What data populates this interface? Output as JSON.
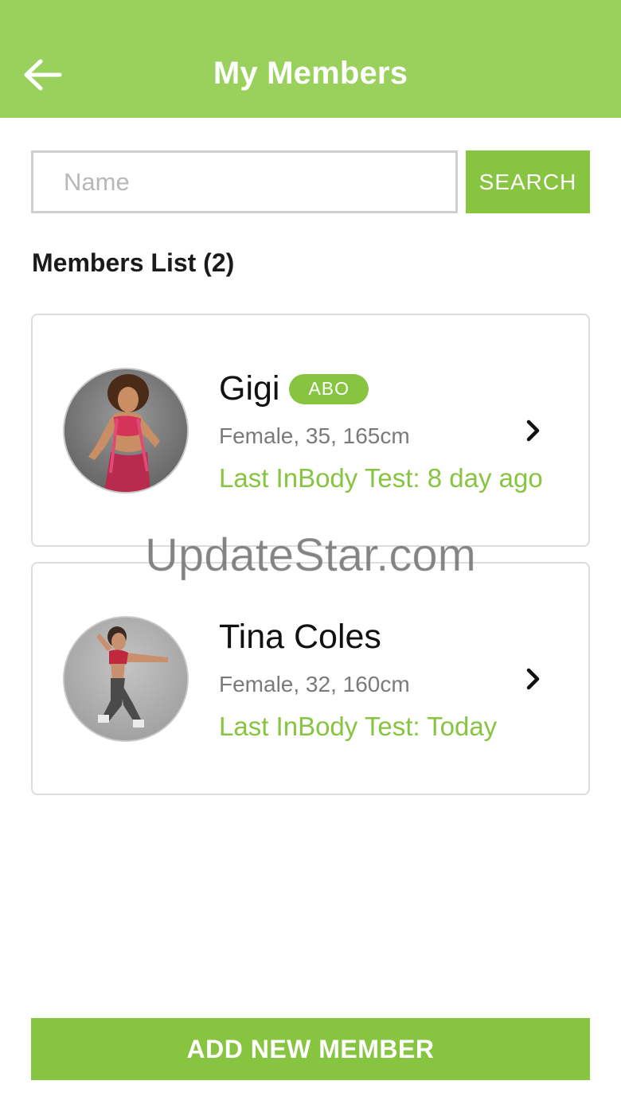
{
  "header": {
    "title": "My Members",
    "back_icon": "arrow-left-icon",
    "background_color": "#99d15c"
  },
  "search": {
    "placeholder": "Name",
    "value": "",
    "button_label": "SEARCH"
  },
  "members_list": {
    "title": "Members List (2)",
    "members": [
      {
        "name": "Gigi",
        "badge": "ABO",
        "info": "Female, 35, 165cm",
        "last_test": "Last InBody Test: 8 day ago",
        "avatar": "member-photo",
        "chevron_icon": "chevron-right-icon"
      },
      {
        "name": "Tina Coles",
        "badge": "",
        "info": "Female, 32, 160cm",
        "last_test": "Last InBody Test: Today",
        "avatar": "member-photo",
        "chevron_icon": "chevron-right-icon"
      }
    ]
  },
  "watermark": "UpdateStar.com",
  "footer": {
    "add_button_label": "ADD NEW MEMBER"
  },
  "colors": {
    "accent": "#87c541",
    "header": "#99d15c",
    "text_secondary": "#7a7a7a"
  }
}
